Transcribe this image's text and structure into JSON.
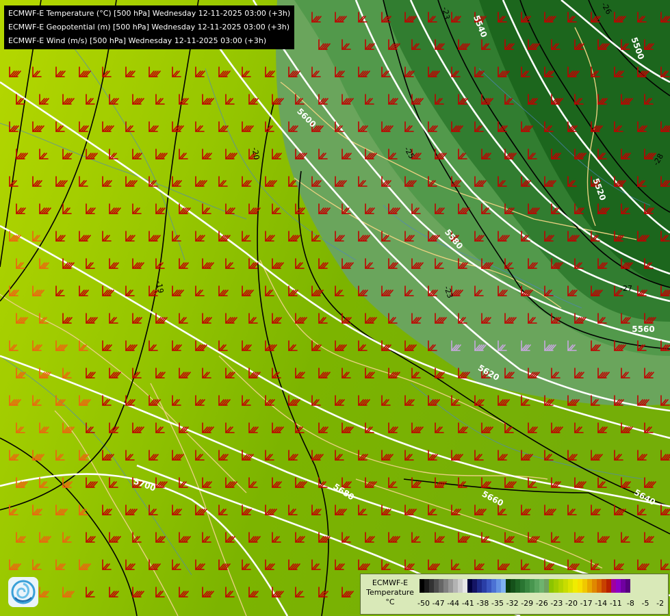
{
  "title_lines": [
    "ECMWF-E Temperature (°C) [500 hPa] Wednesday 12-11-2025 03:00 (+3h)",
    "ECMWF-E Geopotential (m) [500 hPa] Wednesday 12-11-2025 03:00 (+3h)",
    "ECMWF-E Wind (m/s) [500 hPa] Wednesday 12-11-2025 03:00 (+3h)"
  ],
  "geopotential_labels": [
    "5500",
    "5520",
    "5540",
    "5560",
    "5580",
    "5600",
    "5620",
    "5640",
    "5660",
    "5680",
    "5700"
  ],
  "temperature_labels": [
    "-19",
    "-20",
    "-23",
    "-25",
    "-26",
    "-27",
    "-28"
  ],
  "legend": {
    "title": "ECMWF-E\nTemperature\n°C",
    "tick_labels": [
      "-50",
      "-47",
      "-44",
      "-41",
      "-38",
      "-35",
      "-32",
      "-29",
      "-26",
      "-23",
      "-20",
      "-17",
      "-14",
      "-11",
      "-8",
      "-5",
      "-2"
    ],
    "colors": [
      "#000000",
      "#1a1a1a",
      "#333333",
      "#4d4d4d",
      "#666666",
      "#808080",
      "#999999",
      "#b3b3b3",
      "#cccccc",
      "#e6e6e6",
      "#00003c",
      "#141464",
      "#1e2a8a",
      "#2a3ea6",
      "#3a56c0",
      "#4c72d4",
      "#6492e4",
      "#80b2f0",
      "#0b3d0b",
      "#15511a",
      "#1e6324",
      "#2a7532",
      "#388640",
      "#48964f",
      "#5aa55f",
      "#6eb36e",
      "#6fa060",
      "#8cc400",
      "#a0cc00",
      "#b4d400",
      "#c8dc00",
      "#dce400",
      "#f0ec00",
      "#f8e000",
      "#f0c800",
      "#e8a800",
      "#e08800",
      "#d86800",
      "#c84000",
      "#b82000",
      "#a000a0",
      "#8c00c8",
      "#7000a0",
      "#580080"
    ],
    "colorbar_scale": {
      "min": -50,
      "max": -2,
      "step": 3
    }
  },
  "colors": {
    "background_warm": "#b5d800",
    "background_mid": "#7fb800",
    "cold_zone_light": "#6aa55c",
    "cold_zone_dark": "#1e6a1e",
    "geopotential_line": "#ffffff",
    "temperature_line": "#000000",
    "wind_barb_red": "#c00000",
    "wind_barb_orange": "#f06010",
    "wind_barb_lilac": "#c8a8e0",
    "border_line": "#e8d080",
    "river_line": "#4f84c0"
  },
  "icons": {
    "logo": "ecmwf-logo-icon"
  }
}
